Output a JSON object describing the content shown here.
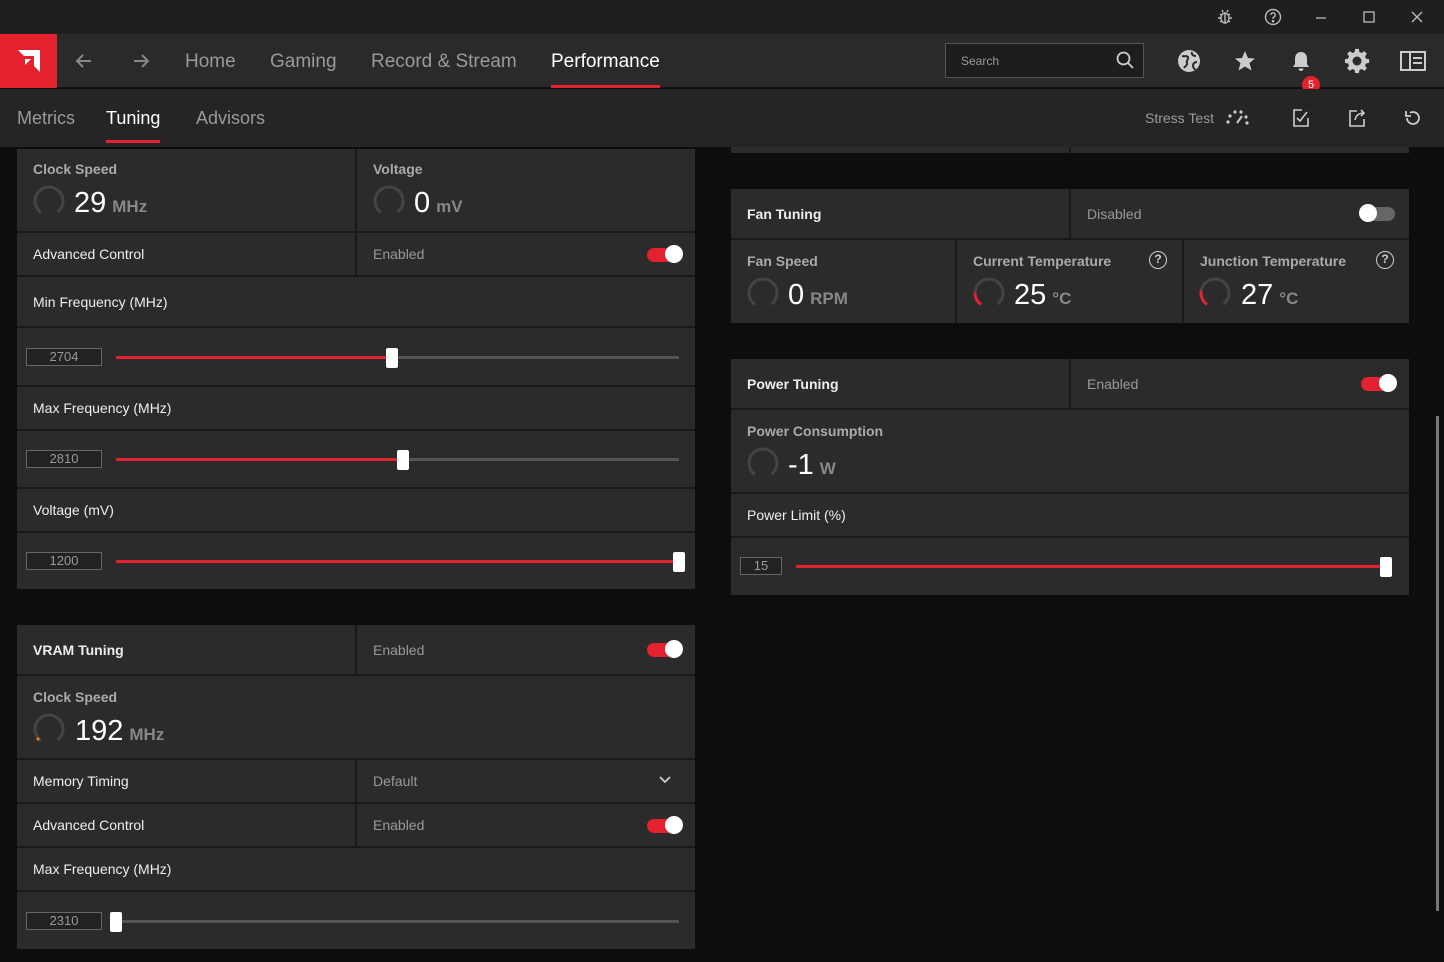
{
  "titlebar": {
    "icons": [
      "bug-icon",
      "help-icon",
      "minimize-icon",
      "maximize-icon",
      "close-icon"
    ]
  },
  "nav": {
    "back_icon": "arrow-left-icon",
    "forward_icon": "arrow-right-icon",
    "items": [
      {
        "label": "Home"
      },
      {
        "label": "Gaming"
      },
      {
        "label": "Record & Stream"
      },
      {
        "label": "Performance",
        "active": true
      }
    ],
    "search_placeholder": "Search",
    "notification_count": "5",
    "icons": [
      "globe-icon",
      "star-icon",
      "bell-icon",
      "gear-icon",
      "layout-icon"
    ]
  },
  "subnav": {
    "items": [
      {
        "label": "Metrics"
      },
      {
        "label": "Tuning",
        "active": true
      },
      {
        "label": "Advisors"
      }
    ],
    "stress_test": "Stress Test"
  },
  "gpu": {
    "clock_speed_title": "Clock Speed",
    "clock_speed_value": "29",
    "clock_speed_unit": "MHz",
    "voltage_title": "Voltage",
    "voltage_value": "0",
    "voltage_unit": "mV",
    "advanced_control_label": "Advanced Control",
    "advanced_control_value": "Enabled",
    "min_freq_label": "Min Frequency (MHz)",
    "min_freq_value": "2704",
    "min_freq_fraction": 0.49,
    "max_freq_label": "Max Frequency (MHz)",
    "max_freq_value": "2810",
    "max_freq_fraction": 0.51,
    "voltage_slider_label": "Voltage (mV)",
    "voltage_slider_value": "1200",
    "voltage_slider_fraction": 1.0
  },
  "vram": {
    "title": "VRAM Tuning",
    "status": "Enabled",
    "clock_speed_title": "Clock Speed",
    "clock_speed_value": "192",
    "clock_speed_unit": "MHz",
    "memory_timing_label": "Memory Timing",
    "memory_timing_value": "Default",
    "advanced_control_label": "Advanced Control",
    "advanced_control_value": "Enabled",
    "max_freq_label": "Max Frequency (MHz)",
    "max_freq_value": "2310",
    "max_freq_fraction": 0.0
  },
  "fan": {
    "title": "Fan Tuning",
    "status": "Disabled",
    "fan_speed_title": "Fan Speed",
    "fan_speed_value": "0",
    "fan_speed_unit": "RPM",
    "current_temp_title": "Current Temperature",
    "current_temp_value": "25",
    "current_temp_unit": "°C",
    "junction_temp_title": "Junction Temperature",
    "junction_temp_value": "27",
    "junction_temp_unit": "°C"
  },
  "power": {
    "title": "Power Tuning",
    "status": "Enabled",
    "consumption_title": "Power Consumption",
    "consumption_value": "-1",
    "consumption_unit": "W",
    "limit_label": "Power Limit (%)",
    "limit_value": "15",
    "limit_fraction": 1.0
  },
  "colors": {
    "accent": "#e3212f",
    "panel": "#2b2b2b",
    "background": "#0d0d0d"
  }
}
